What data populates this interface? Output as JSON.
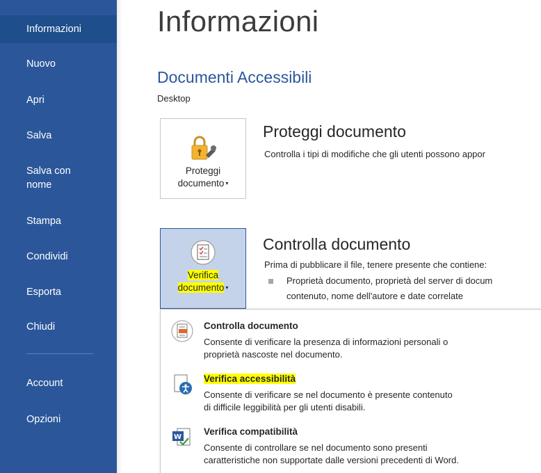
{
  "sidebar": {
    "items": [
      {
        "label": "Informazioni",
        "selected": true
      },
      {
        "label": "Nuovo"
      },
      {
        "label": "Apri"
      },
      {
        "label": "Salva"
      },
      {
        "label": "Salva con nome"
      },
      {
        "label": "Stampa"
      },
      {
        "label": "Condividi"
      },
      {
        "label": "Esporta"
      },
      {
        "label": "Chiudi"
      },
      {
        "label": "Account"
      },
      {
        "label": "Opzioni"
      }
    ]
  },
  "main": {
    "page_title": "Informazioni",
    "document_title": "Documenti Accessibili",
    "document_path": "Desktop",
    "protect": {
      "button_line1": "Proteggi",
      "button_line2": "documento",
      "title": "Proteggi documento",
      "description": "Controlla i tipi di modifiche che gli utenti possono appor"
    },
    "inspect": {
      "button_line1": "Verifica",
      "button_line2": "documento",
      "title": "Controlla documento",
      "description": "Prima di pubblicare il file, tenere presente che contiene:",
      "bullet_line1": "Proprietà documento, proprietà del server di docum",
      "bullet_line2": "contenuto, nome dell'autore e date correlate"
    }
  },
  "dropdown": {
    "items": [
      {
        "title": "Controlla documento",
        "desc_line1": "Consente di verificare la presenza di informazioni personali o",
        "desc_line2": "proprietà nascoste nel documento.",
        "icon": "inspect-document-icon"
      },
      {
        "title": "Verifica accessibilità",
        "desc_line1": "Consente di verificare se nel documento è presente contenuto",
        "desc_line2": "di difficile leggibilità per gli utenti disabili.",
        "icon": "accessibility-checker-icon",
        "highlighted": true
      },
      {
        "title": "Verifica compatibilità",
        "desc_line1": "Consente di controllare se nel documento sono presenti",
        "desc_line2": "caratteristiche non supportate dalle versioni precedenti di Word.",
        "icon": "compatibility-checker-icon"
      }
    ]
  },
  "colors": {
    "sidebar_bg": "#2b579a",
    "accent": "#2b579a",
    "highlight": "#ffff00",
    "active_button_bg": "#c5d3ea"
  }
}
